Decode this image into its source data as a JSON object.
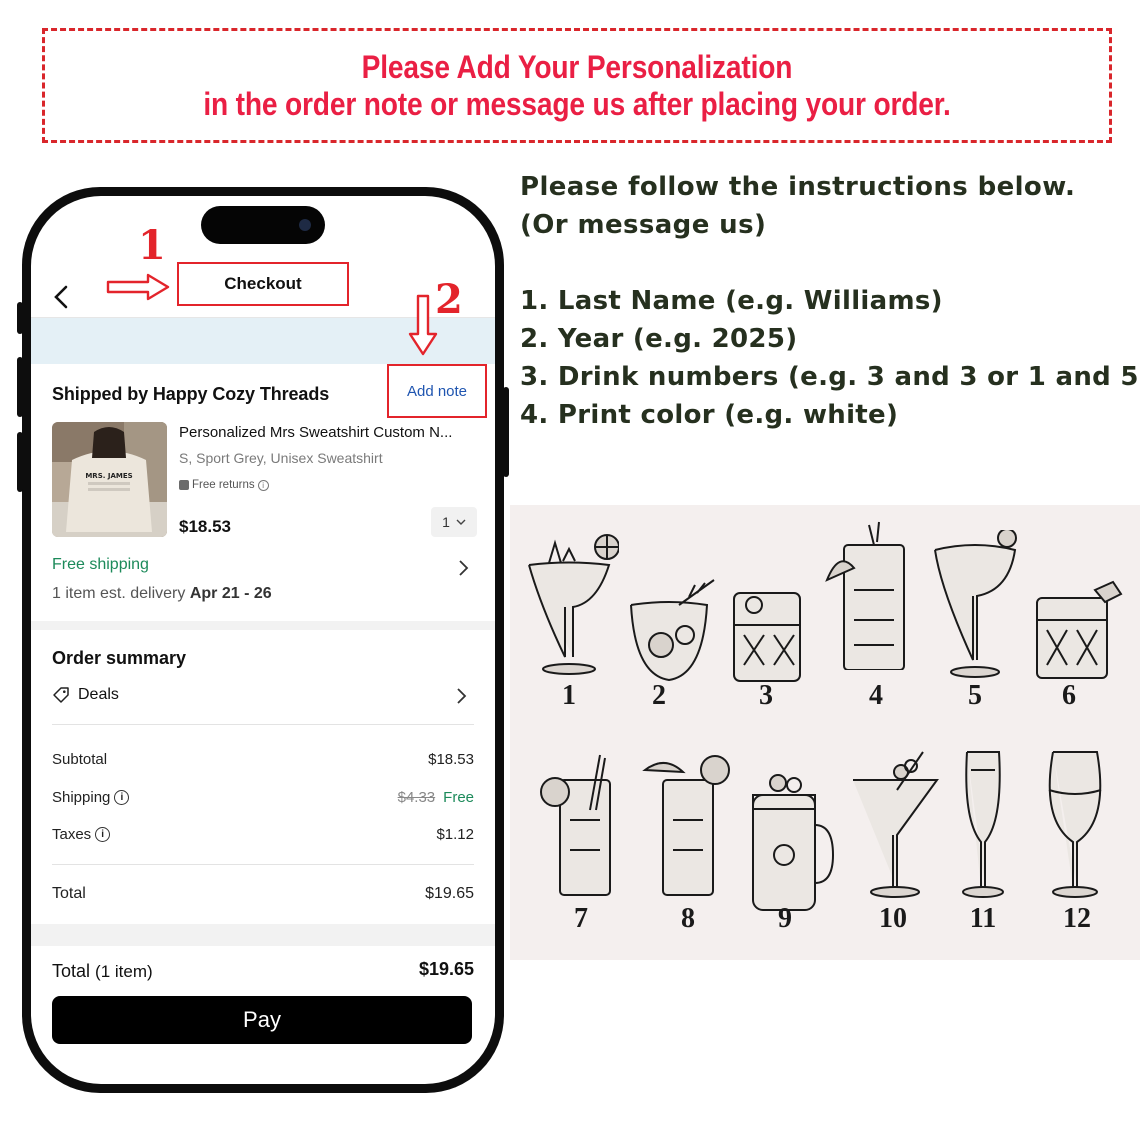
{
  "banner": {
    "line1": "Please Add Your Personalization",
    "line2": "in the order note or message us after placing your order."
  },
  "instructions": {
    "intro_line1": "Please follow the instructions below.",
    "intro_line2": "(Or message us)",
    "steps": [
      "1. Last Name (e.g. Williams)",
      "2. Year (e.g. 2025)",
      "3. Drink numbers (e.g. 3 and 3 or 1 and 5)",
      "4. Print color (e.g. white)"
    ]
  },
  "annotations": {
    "step1": "1",
    "step2": "2"
  },
  "phone": {
    "header_title": "Checkout",
    "shipped_by": "Shipped by Happy Cozy Threads",
    "add_note": "Add note",
    "thumb_text": "MRS. JAMES",
    "product": {
      "title": "Personalized Mrs Sweatshirt Custom N...",
      "variant": "S, Sport Grey, Unisex Sweatshirt",
      "returns": "Free returns",
      "price": "$18.53",
      "qty": "1"
    },
    "free_shipping": "Free shipping",
    "delivery_prefix": "1 item est. delivery ",
    "delivery_dates": "Apr 21 - 26",
    "summary": {
      "title": "Order summary",
      "deals": "Deals",
      "subtotal_label": "Subtotal",
      "subtotal_value": "$18.53",
      "shipping_label": "Shipping",
      "shipping_old": "$4.33",
      "shipping_value": "Free",
      "taxes_label": "Taxes",
      "taxes_value": "$1.12",
      "total_label": "Total",
      "total_value": "$19.65"
    },
    "footer": {
      "total_label": "Total",
      "total_count": "(1 item)",
      "total_value": "$19.65",
      "pay": "Pay"
    }
  },
  "drinks": {
    "labels": [
      "1",
      "2",
      "3",
      "4",
      "5",
      "6",
      "7",
      "8",
      "9",
      "10",
      "11",
      "12"
    ]
  },
  "colors": {
    "banner_red": "#ea1f44",
    "annotation_red": "#e3242b",
    "instruction_text": "#26301f",
    "free_green": "#1c8a5a",
    "link_blue": "#1f55b0",
    "drinks_bg": "#f4efee"
  }
}
